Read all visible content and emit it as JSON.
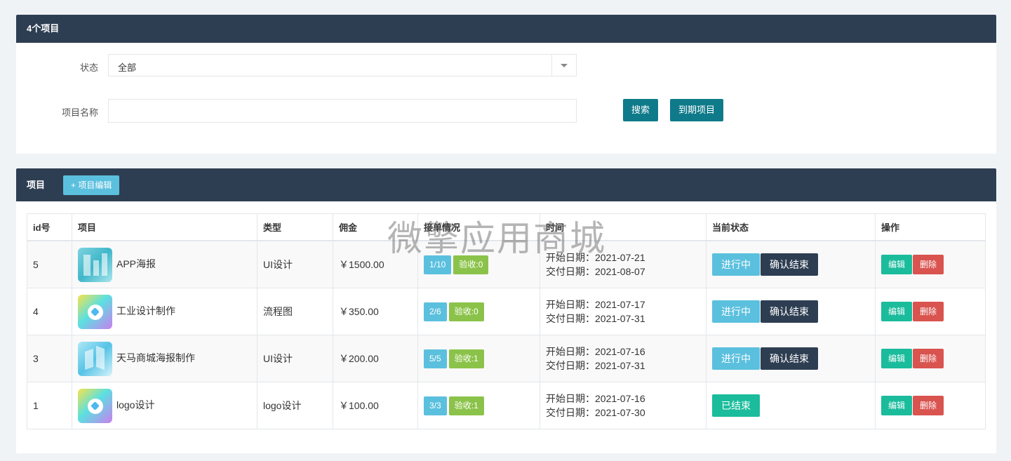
{
  "filter_panel": {
    "title": "4个项目",
    "status_label": "状态",
    "status_value": "全部",
    "name_label": "项目名称",
    "name_value": "",
    "search_button": "搜索",
    "expired_button": "到期项目"
  },
  "list_panel": {
    "title": "项目",
    "add_button": "+ 项目编辑",
    "columns": [
      "id号",
      "项目",
      "类型",
      "佣金",
      "接单情况",
      "时间",
      "当前状态",
      "操作"
    ],
    "rows": [
      {
        "id": "5",
        "name": "APP海报",
        "thumb": "poster-image",
        "type": "UI设计",
        "fee": "￥1500.00",
        "orders": "1/10",
        "accepted": "验收:0",
        "start": "开始日期：2021-07-21",
        "end": "交付日期：2021-08-07",
        "status": "进行中",
        "action": "确认结束",
        "edit": "编辑",
        "delete": "删除"
      },
      {
        "id": "4",
        "name": "工业设计制作",
        "thumb": "tag-icon",
        "type": "流程图",
        "fee": "￥350.00",
        "orders": "2/6",
        "accepted": "验收:0",
        "start": "开始日期：2021-07-17",
        "end": "交付日期：2021-07-31",
        "status": "进行中",
        "action": "确认结束",
        "edit": "编辑",
        "delete": "删除"
      },
      {
        "id": "3",
        "name": "天马商城海报制作",
        "thumb": "building-image",
        "type": "UI设计",
        "fee": "￥200.00",
        "orders": "5/5",
        "accepted": "验收:1",
        "start": "开始日期：2021-07-16",
        "end": "交付日期：2021-07-31",
        "status": "进行中",
        "action": "确认结束",
        "edit": "编辑",
        "delete": "删除"
      },
      {
        "id": "1",
        "name": "logo设计",
        "thumb": "tag-icon",
        "type": "logo设计",
        "fee": "￥100.00",
        "orders": "3/3",
        "accepted": "验收:1",
        "start": "开始日期：2021-07-16",
        "end": "交付日期：2021-07-30",
        "status": "已结束",
        "action": "",
        "edit": "编辑",
        "delete": "删除"
      }
    ]
  },
  "watermark": "微擎应用商城",
  "colors": {
    "header_bg": "#2e3e52",
    "primary_btn": "#0f7a8a",
    "info": "#5bc0de",
    "success": "#8bc34a",
    "teal": "#1abc9c",
    "danger": "#d9534f"
  }
}
